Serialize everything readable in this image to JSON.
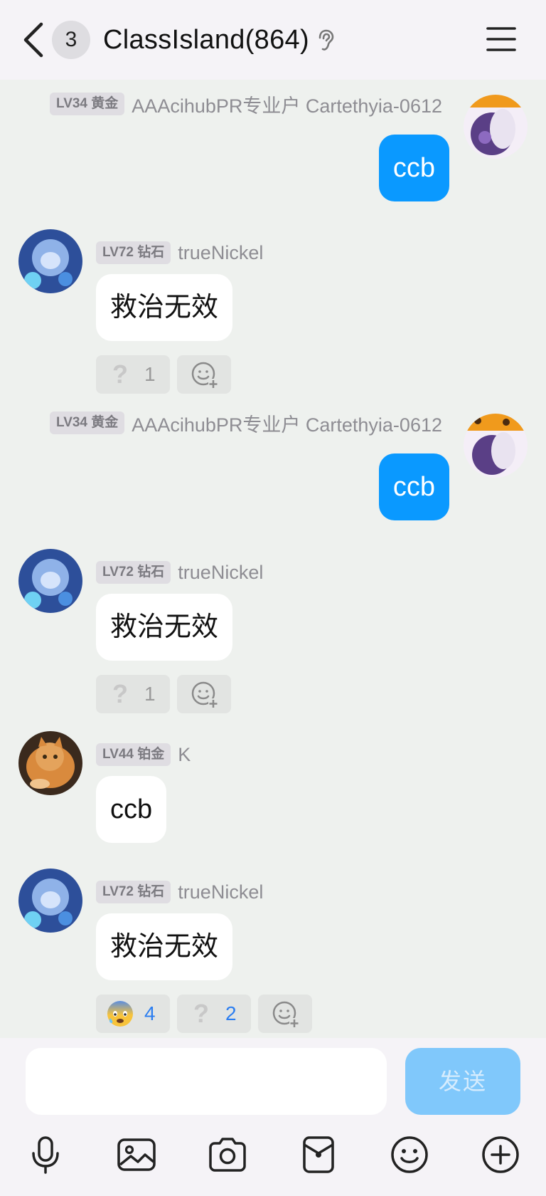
{
  "header": {
    "unread_count": "3",
    "title": "ClassIsland(864)",
    "icons": {
      "back": "back-chevron-icon",
      "ear": "ear-icon",
      "menu": "hamburger-menu-icon"
    }
  },
  "messages": [
    {
      "side": "out",
      "badge": "LV34 黄金",
      "name": "AAAcihubPR专业户 Cartethyia-0612",
      "text": "ccb"
    },
    {
      "side": "in",
      "badge": "LV72 钻石",
      "name": "trueNickel",
      "text": "救治无效",
      "reactions": [
        {
          "icon": "question-mark",
          "count": "1"
        }
      ]
    },
    {
      "side": "out",
      "badge": "LV34 黄金",
      "name": "AAAcihubPR专业户 Cartethyia-0612",
      "text": "ccb"
    },
    {
      "side": "in",
      "badge": "LV72 钻石",
      "name": "trueNickel",
      "text": "救治无效",
      "reactions": [
        {
          "icon": "question-mark",
          "count": "1"
        }
      ]
    },
    {
      "side": "in",
      "badge": "LV44 铂金",
      "name": "K",
      "text": "ccb"
    },
    {
      "side": "in",
      "badge": "LV72 钻石",
      "name": "trueNickel",
      "text": "救治无效",
      "reactions": [
        {
          "icon": "anxious-face-emoji",
          "count": "4"
        },
        {
          "icon": "question-mark",
          "count": "2"
        }
      ]
    }
  ],
  "composer": {
    "placeholder": "",
    "send_label": "发送",
    "tools": [
      "microphone-icon",
      "image-icon",
      "camera-icon",
      "red-packet-icon",
      "emoji-icon",
      "plus-icon"
    ]
  },
  "colors": {
    "accent": "#0a99ff",
    "send_disabled": "#80c8fb",
    "chat_background": "#eef1ee",
    "header_background": "#f5f3f7"
  }
}
